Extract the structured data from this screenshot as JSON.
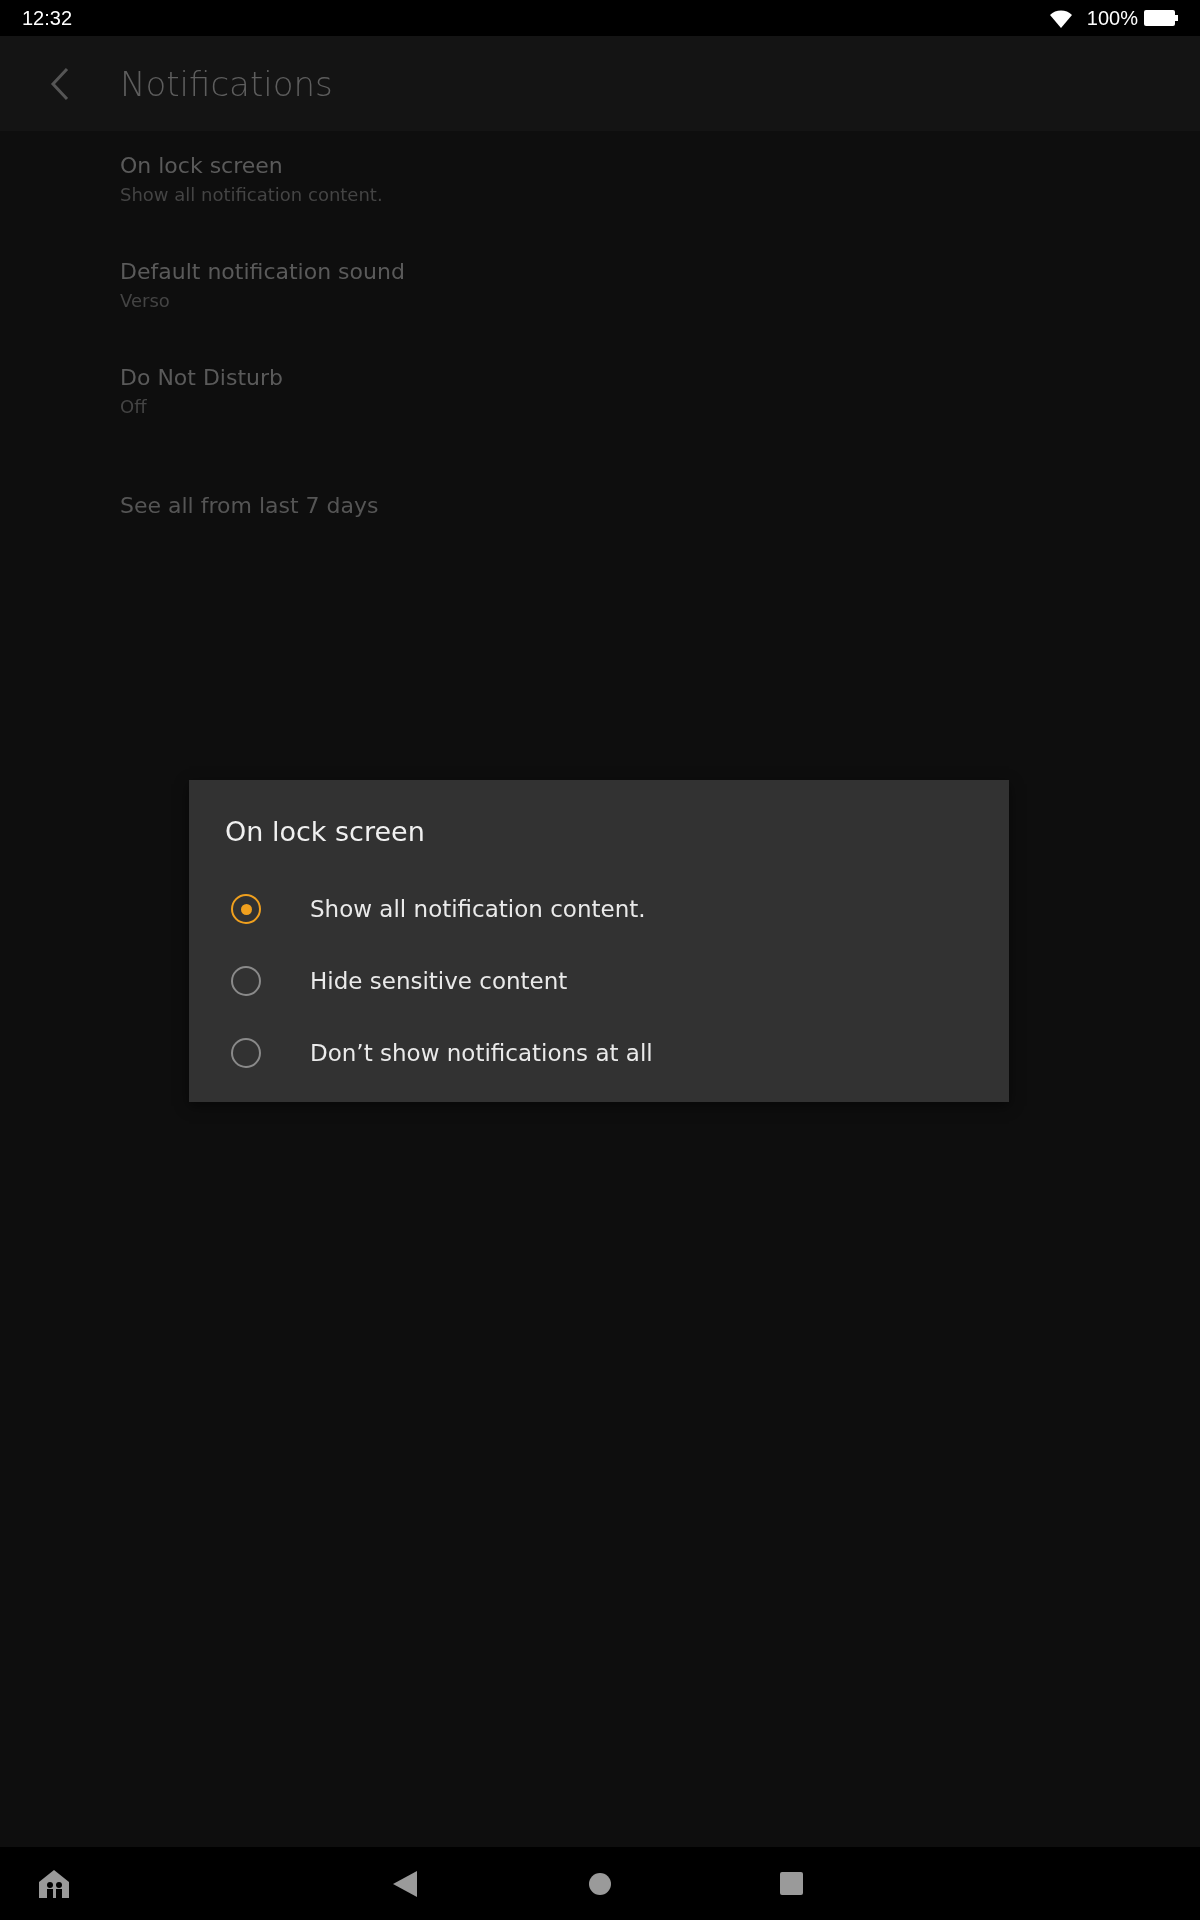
{
  "status_bar": {
    "time": "12:32",
    "battery": "100%"
  },
  "app_bar": {
    "title": "Notifications"
  },
  "settings": [
    {
      "title": "On lock screen",
      "subtitle": "Show all notification content."
    },
    {
      "title": "Default notification sound",
      "subtitle": "Verso"
    },
    {
      "title": "Do Not Disturb",
      "subtitle": "Off"
    }
  ],
  "history_link": "See all from last 7 days",
  "dialog": {
    "title": "On lock screen",
    "options": [
      {
        "label": "Show all notification content.",
        "selected": true
      },
      {
        "label": "Hide sensitive content",
        "selected": false
      },
      {
        "label": "Don’t show notifications at all",
        "selected": false
      }
    ]
  }
}
